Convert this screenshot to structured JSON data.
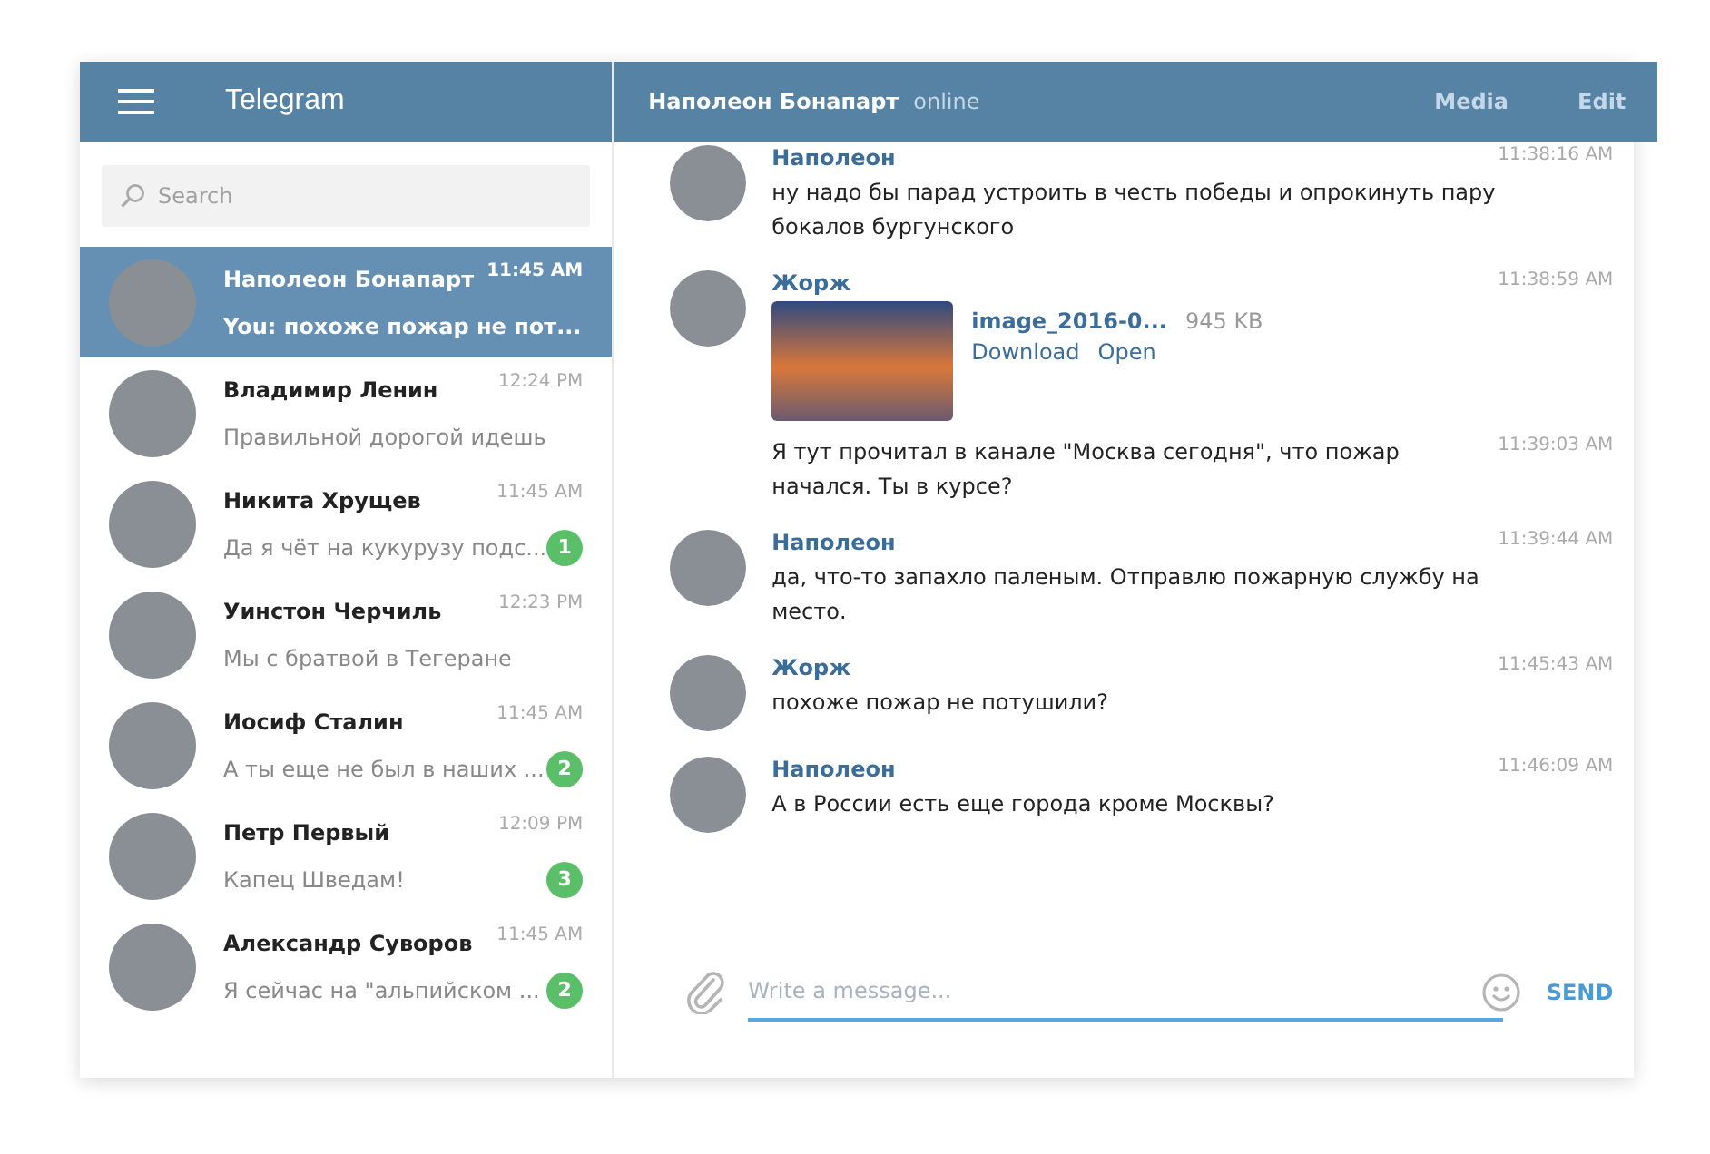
{
  "header": {
    "app_title": "Telegram",
    "chat_title": "Наполеон Бонапарт",
    "chat_status": "online",
    "actions": [
      "Media",
      "Edit"
    ]
  },
  "search": {
    "placeholder": "Search"
  },
  "chats": [
    {
      "name": "Наполеон Бонапарт",
      "time": "11:45 AM",
      "preview": "You: похоже пожар не пот...",
      "selected": true
    },
    {
      "name": "Владимир Ленин",
      "time": "12:24 PM",
      "preview": "Правильной дорогой идешь",
      "selected": false
    },
    {
      "name": "Никита Хрущев",
      "time": "11:45 AM",
      "preview": "Да я чёт на кукурузу подс...",
      "unread": "1",
      "selected": false
    },
    {
      "name": "Уинстон Черчиль",
      "time": "12:23 PM",
      "preview": "Мы с братвой в Тегеране",
      "selected": false
    },
    {
      "name": "Иосиф Сталин",
      "time": "11:45 AM",
      "preview": "А ты еще не был в наших ...",
      "unread": "2",
      "selected": false
    },
    {
      "name": "Петр Первый",
      "time": "12:09 PM",
      "preview": "Капец Шведам!",
      "unread": "3",
      "selected": false
    },
    {
      "name": "Александр Суворов",
      "time": "11:45 AM",
      "preview": "Я сейчас на \"альпийском ...",
      "unread": "2",
      "selected": false
    }
  ],
  "messages": [
    {
      "kind": "message",
      "author": "Наполеон",
      "time": "11:38:16 AM",
      "text": "ну надо бы парад устроить в честь победы и опрокинуть пару бокалов бургунского"
    },
    {
      "kind": "file",
      "author": "Жорж",
      "time": "11:38:59 AM",
      "file_name": "image_2016-0...",
      "file_size": "945 KB",
      "file_actions": [
        "Download",
        "Open"
      ]
    },
    {
      "kind": "continuation",
      "time": "11:39:03 AM",
      "text": "Я тут прочитал в канале \"Москва сегодня\", что пожар начался. Ты в курсе?"
    },
    {
      "kind": "message",
      "author": "Наполеон",
      "time": "11:39:44 AM",
      "text": "да, что-то запахло паленым. Отправлю пожарную службу на место."
    },
    {
      "kind": "message",
      "author": "Жорж",
      "time": "11:45:43 AM",
      "text": "похоже пожар не потушили?"
    },
    {
      "kind": "message",
      "author": "Наполеон",
      "time": "11:46:09 AM",
      "text": "А в России есть еще города кроме Москвы?"
    }
  ],
  "composer": {
    "placeholder": "Write a message...",
    "send": "SEND"
  }
}
